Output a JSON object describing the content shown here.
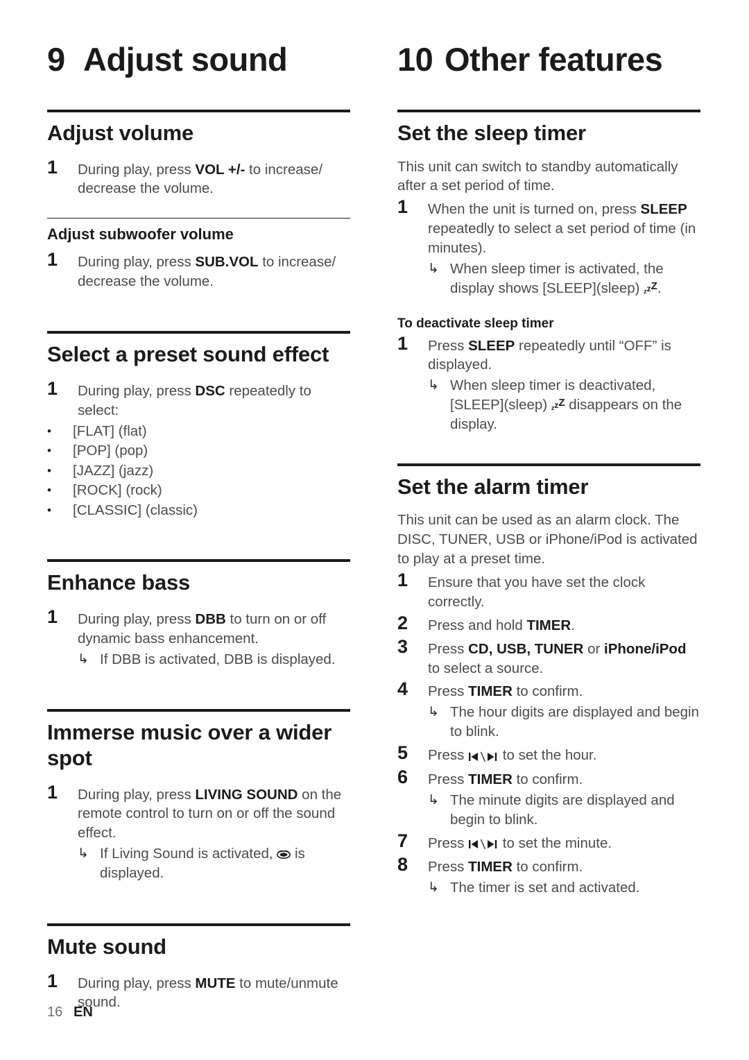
{
  "page": {
    "number": "16",
    "language": "EN"
  },
  "left_column": {
    "chapter": {
      "number": "9",
      "title": "Adjust sound"
    },
    "sections": [
      {
        "heading": "Adjust volume",
        "steps": [
          {
            "n": "1",
            "pre": "During play, press ",
            "kw": "VOL +/-",
            "post": " to increase/ decrease the volume."
          }
        ],
        "subheading": "Adjust subwoofer volume",
        "sub_steps": [
          {
            "n": "1",
            "pre": "During play, press ",
            "kw": "SUB.VOL",
            "post": " to increase/ decrease the volume."
          }
        ]
      },
      {
        "heading": "Select a preset sound effect",
        "steps": [
          {
            "n": "1",
            "pre": "During play, press ",
            "kw": "DSC",
            "post": " repeatedly to select:"
          }
        ],
        "bullets": [
          "[FLAT] (flat)",
          "[POP] (pop)",
          "[JAZZ] (jazz)",
          "[ROCK] (rock)",
          "[CLASSIC] (classic)"
        ]
      },
      {
        "heading": "Enhance bass",
        "steps": [
          {
            "n": "1",
            "pre": "During play, press ",
            "kw": "DBB",
            "post": " to turn on or off dynamic bass enhancement."
          }
        ],
        "note": "If DBB is activated, DBB is displayed."
      },
      {
        "heading": "Immerse music over a wider spot",
        "steps": [
          {
            "n": "1",
            "pre": "During play, press ",
            "kw": "LIVING SOUND",
            "post": " on the remote control to turn on or off the sound effect."
          }
        ],
        "note_pre": "If Living Sound is activated, ",
        "note_icon": "living-sound-icon",
        "note_post": " is displayed."
      },
      {
        "heading": "Mute sound",
        "steps": [
          {
            "n": "1",
            "pre": "During play, press ",
            "kw": "MUTE",
            "post": " to mute/unmute sound."
          }
        ]
      }
    ]
  },
  "right_column": {
    "chapter": {
      "number": "10",
      "title": "Other features"
    },
    "sleep": {
      "heading": "Set the sleep timer",
      "intro": "This unit can switch to standby automatically after a set period of time.",
      "step1": {
        "n": "1",
        "pre": "When the unit is turned on, press ",
        "kw": "SLEEP",
        "post": " repeatedly to select a set period of time (in minutes)."
      },
      "note1_pre": "When sleep timer is activated, the display shows [SLEEP](sleep) ",
      "note1_icon": "sleep-zzz-icon",
      "note1_post": ".",
      "deactivate_heading": "To deactivate sleep timer",
      "deact_step": {
        "n": "1",
        "pre": "Press ",
        "kw": "SLEEP",
        "post": " repeatedly until “OFF” is displayed."
      },
      "note2_pre": "When sleep timer is deactivated, [SLEEP](sleep) ",
      "note2_icon": "sleep-zzz-icon",
      "note2_post": " disappears on the display."
    },
    "alarm": {
      "heading": "Set the alarm timer",
      "intro": "This unit can be used as an alarm clock. The DISC, TUNER, USB or iPhone/iPod is activated to play at a preset time.",
      "steps": [
        {
          "n": "1",
          "pre": "Ensure that you have set the clock correctly.",
          "kw": "",
          "post": ""
        },
        {
          "n": "2",
          "pre": "Press and hold ",
          "kw": "TIMER",
          "post": "."
        },
        {
          "n": "3",
          "pre": "Press ",
          "kw": "CD, USB, TUNER",
          "mid": " or ",
          "kw2": "iPhone/iPod",
          "post": " to select a source."
        },
        {
          "n": "4",
          "pre": "Press ",
          "kw": "TIMER",
          "post": " to confirm."
        }
      ],
      "note_hour": "The hour digits are displayed and begin to blink.",
      "step5": {
        "n": "5",
        "pre": "Press ",
        "icon": "skip-prev-next-icon",
        "post": " to set the hour."
      },
      "step6": {
        "n": "6",
        "pre": "Press ",
        "kw": "TIMER",
        "post": " to confirm."
      },
      "note_minute": "The minute digits are displayed and begin to blink.",
      "step7": {
        "n": "7",
        "pre": "Press ",
        "icon": "skip-prev-next-icon",
        "post": " to set the minute."
      },
      "step8": {
        "n": "8",
        "pre": "Press ",
        "kw": "TIMER",
        "post": " to confirm."
      },
      "note_final": "The timer is set and activated."
    }
  },
  "icons": {
    "arrow_result": "↳",
    "bullet": "•"
  },
  "colors": {
    "heading": "#1b1b1b",
    "body": "#4b4b4b",
    "rule": "#1b1b1b",
    "page_bg": "#ffffff"
  }
}
